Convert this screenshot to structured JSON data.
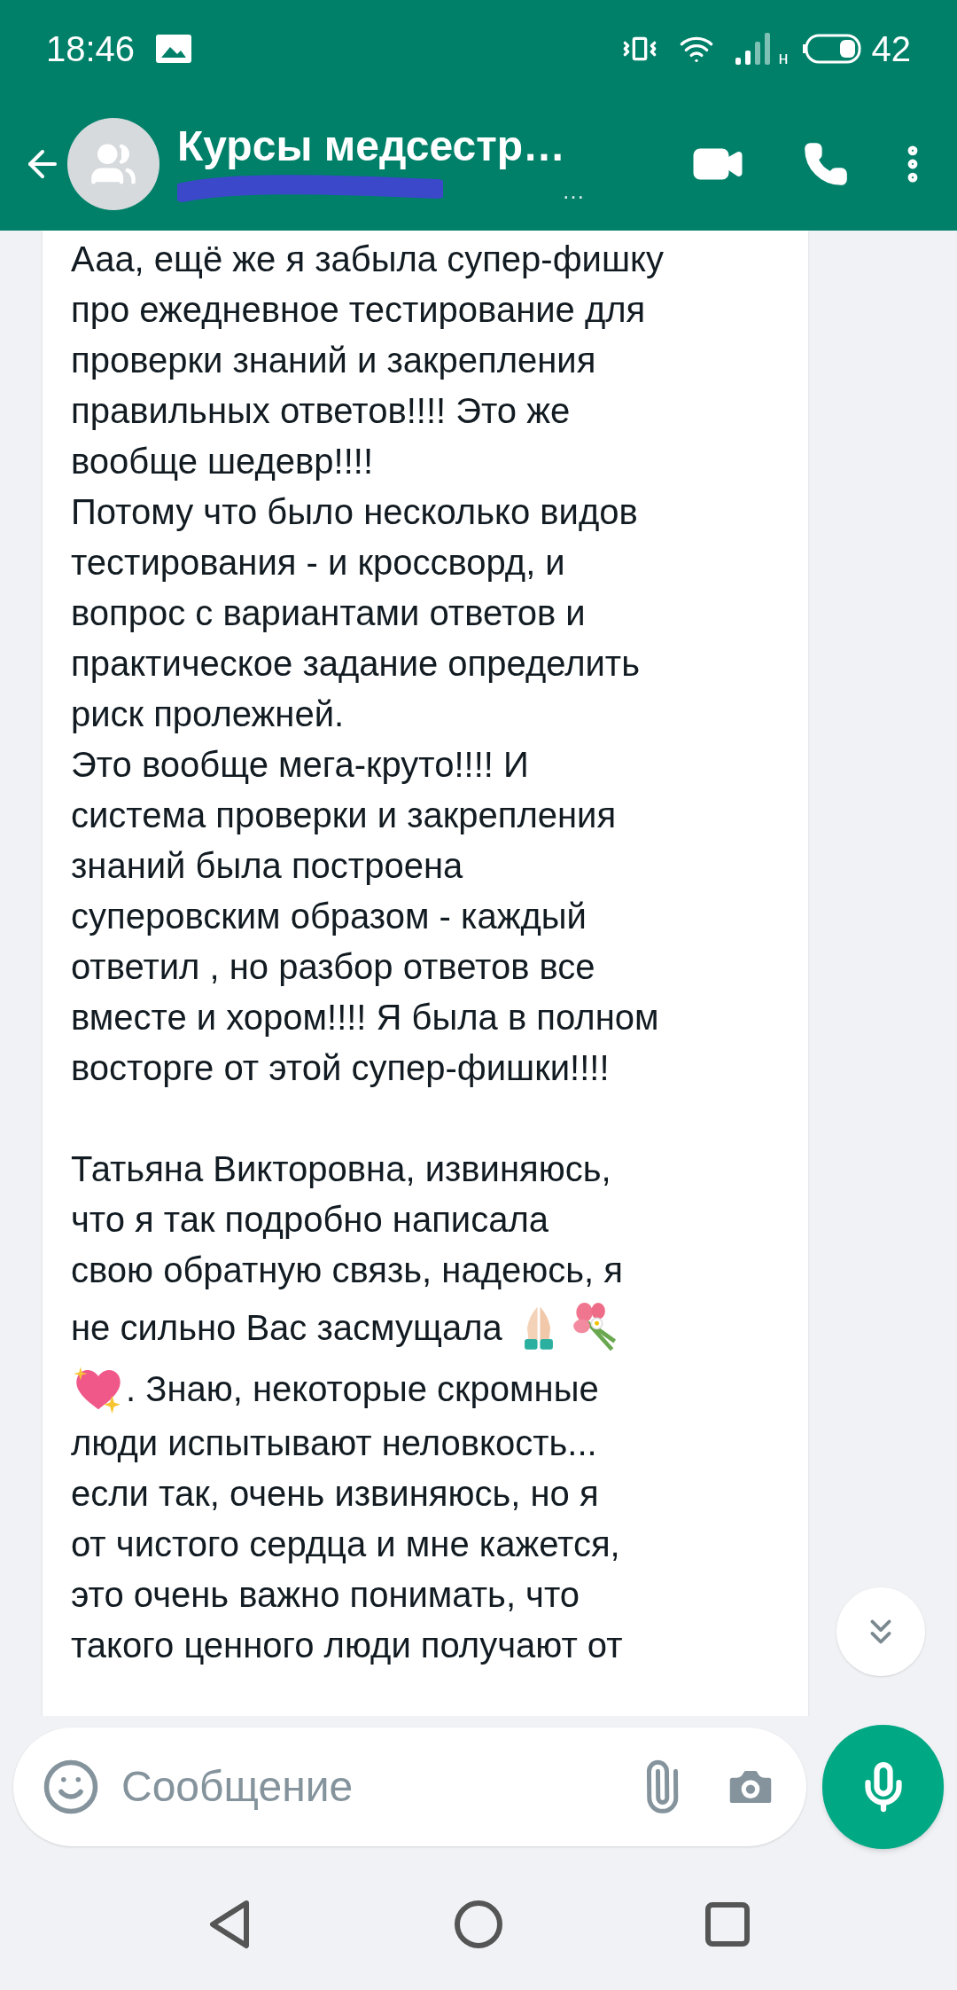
{
  "status_bar": {
    "time": "18:46",
    "network_type": "н",
    "battery": "42"
  },
  "header": {
    "title": "Курсы медсестр…",
    "subtitle": "…"
  },
  "message": {
    "lines": [
      {
        "kind": "text",
        "text": "Ааа, ещё же я забыла супер-фишку"
      },
      {
        "kind": "text",
        "text": "про ежедневное тестирование для"
      },
      {
        "kind": "text",
        "text": "проверки знаний и закрепления"
      },
      {
        "kind": "text",
        "text": "правильных ответов!!!! Это же"
      },
      {
        "kind": "text",
        "text": "вообще шедевр!!!!"
      },
      {
        "kind": "text",
        "text": "Потому что было несколько видов"
      },
      {
        "kind": "text",
        "text": "тестирования - и кроссворд, и"
      },
      {
        "kind": "text",
        "text": "вопрос с вариантами ответов и"
      },
      {
        "kind": "text",
        "text": "практическое задание определить"
      },
      {
        "kind": "text",
        "text": "риск пролежней."
      },
      {
        "kind": "text",
        "text": "Это вообще мега-круто!!!! И"
      },
      {
        "kind": "text",
        "text": "система проверки и закрепления"
      },
      {
        "kind": "text",
        "text": "знаний была построена"
      },
      {
        "kind": "text",
        "text": "суперовским образом - каждый"
      },
      {
        "kind": "text",
        "text": "ответил , но разбор ответов все"
      },
      {
        "kind": "text",
        "text": "вместе и хором!!!! Я была в полном"
      },
      {
        "kind": "text",
        "text": "восторге от этой супер-фишки!!!!"
      },
      {
        "kind": "blank"
      },
      {
        "kind": "text",
        "text": "Татьяна Викторовна,  извиняюсь,"
      },
      {
        "kind": "text",
        "text": "что я так подробно написала"
      },
      {
        "kind": "text",
        "text": "свою обратную связь, надеюсь, я"
      },
      {
        "kind": "emoji_after",
        "text": "не сильно Вас засмущала"
      },
      {
        "kind": "emoji_before",
        "text": ". Знаю, некоторые скромные"
      },
      {
        "kind": "text",
        "text": "люди испытывают неловкость..."
      },
      {
        "kind": "text",
        "text": "если так, очень извиняюсь, но я"
      },
      {
        "kind": "text",
        "text": "от чистого сердца и мне кажется,"
      },
      {
        "kind": "text",
        "text": "это очень важно понимать, что"
      },
      {
        "kind": "text",
        "text": "такого ценного люди получают от"
      }
    ]
  },
  "composer": {
    "placeholder": "Сообщение"
  }
}
